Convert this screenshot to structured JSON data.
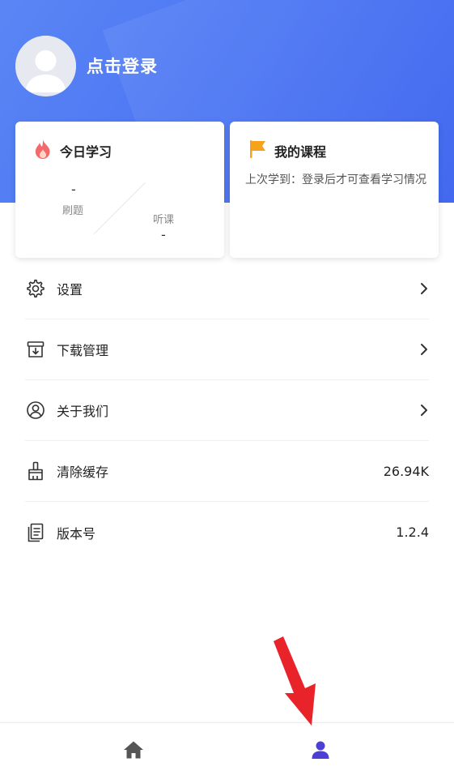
{
  "header": {
    "login_label": "点击登录"
  },
  "today_card": {
    "title": "今日学习",
    "icon": "flame-icon",
    "practice": {
      "value": "-",
      "label": "刷题"
    },
    "listen": {
      "value": "-",
      "label": "听课"
    }
  },
  "course_card": {
    "title": "我的课程",
    "icon": "flag-icon",
    "desc": "上次学到：登录后才可查看学习情况"
  },
  "menu": {
    "items": [
      {
        "label": "设置",
        "icon": "gear-icon",
        "right": ""
      },
      {
        "label": "下载管理",
        "icon": "download-box-icon",
        "right": ""
      },
      {
        "label": "关于我们",
        "icon": "user-circle-icon",
        "right": ""
      },
      {
        "label": "清除缓存",
        "icon": "brush-icon",
        "right": "26.94K"
      },
      {
        "label": "版本号",
        "icon": "document-icon",
        "right": "1.2.4"
      }
    ]
  },
  "tabbar": {
    "tabs": [
      {
        "name": "home",
        "icon": "home-icon"
      },
      {
        "name": "me",
        "icon": "user-icon",
        "active": true
      }
    ]
  },
  "colors": {
    "header_blue": "#4d77f3",
    "accent_active": "#4b3fd6",
    "tab_inactive": "#555555",
    "flame": "#f26b6b",
    "flag": "#f7a21b",
    "arrow_red": "#e8232a"
  }
}
